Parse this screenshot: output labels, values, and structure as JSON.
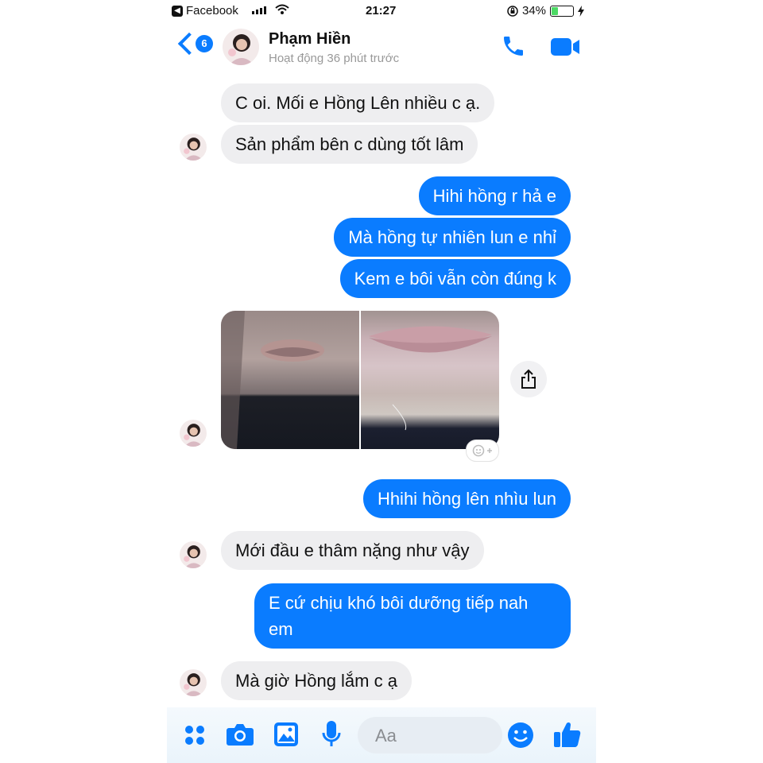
{
  "status_bar": {
    "back_app": "Facebook",
    "time": "21:27",
    "battery_text": "34%",
    "battery_level": 0.34
  },
  "header": {
    "back_count": "6",
    "contact_name": "Phạm Hiền",
    "contact_status": "Hoạt động 36 phút trước"
  },
  "messages": [
    {
      "side": "in",
      "text": "C oi. Mối e Hồng Lên nhiều c ạ."
    },
    {
      "side": "in",
      "text": "Sản phẩm bên c dùng tốt lâm"
    },
    {
      "side": "out",
      "text": "Hihi hồng r hả e"
    },
    {
      "side": "out",
      "text": "Mà hồng tự nhiên lun e nhỉ"
    },
    {
      "side": "out",
      "text": "Kem e bôi vẫn còn đúng k"
    },
    {
      "side": "out",
      "text": "Hhihi hồng lên nhìu lun"
    },
    {
      "side": "in",
      "text": "Mới đầu e thâm nặng như vậy"
    },
    {
      "side": "out",
      "text": "E cứ chịu khó bôi dưỡng tiếp nah"
    },
    {
      "side": "out",
      "text": "em"
    },
    {
      "side": "in",
      "text": "Mà giờ Hồng lắm c ạ"
    }
  ],
  "composer": {
    "placeholder": "Aa"
  },
  "colors": {
    "accent": "#0a7cff",
    "incoming_bubble": "#eeeef0"
  },
  "icons": [
    "facebook-back-icon",
    "signal-icon",
    "wifi-icon",
    "lock-rotation-icon",
    "battery-icon",
    "charging-icon",
    "back-chevron-icon",
    "phone-icon",
    "video-icon",
    "share-icon",
    "add-reaction-icon",
    "menu-dots-icon",
    "camera-icon",
    "gallery-icon",
    "microphone-icon",
    "emoji-icon",
    "thumbs-up-icon"
  ]
}
